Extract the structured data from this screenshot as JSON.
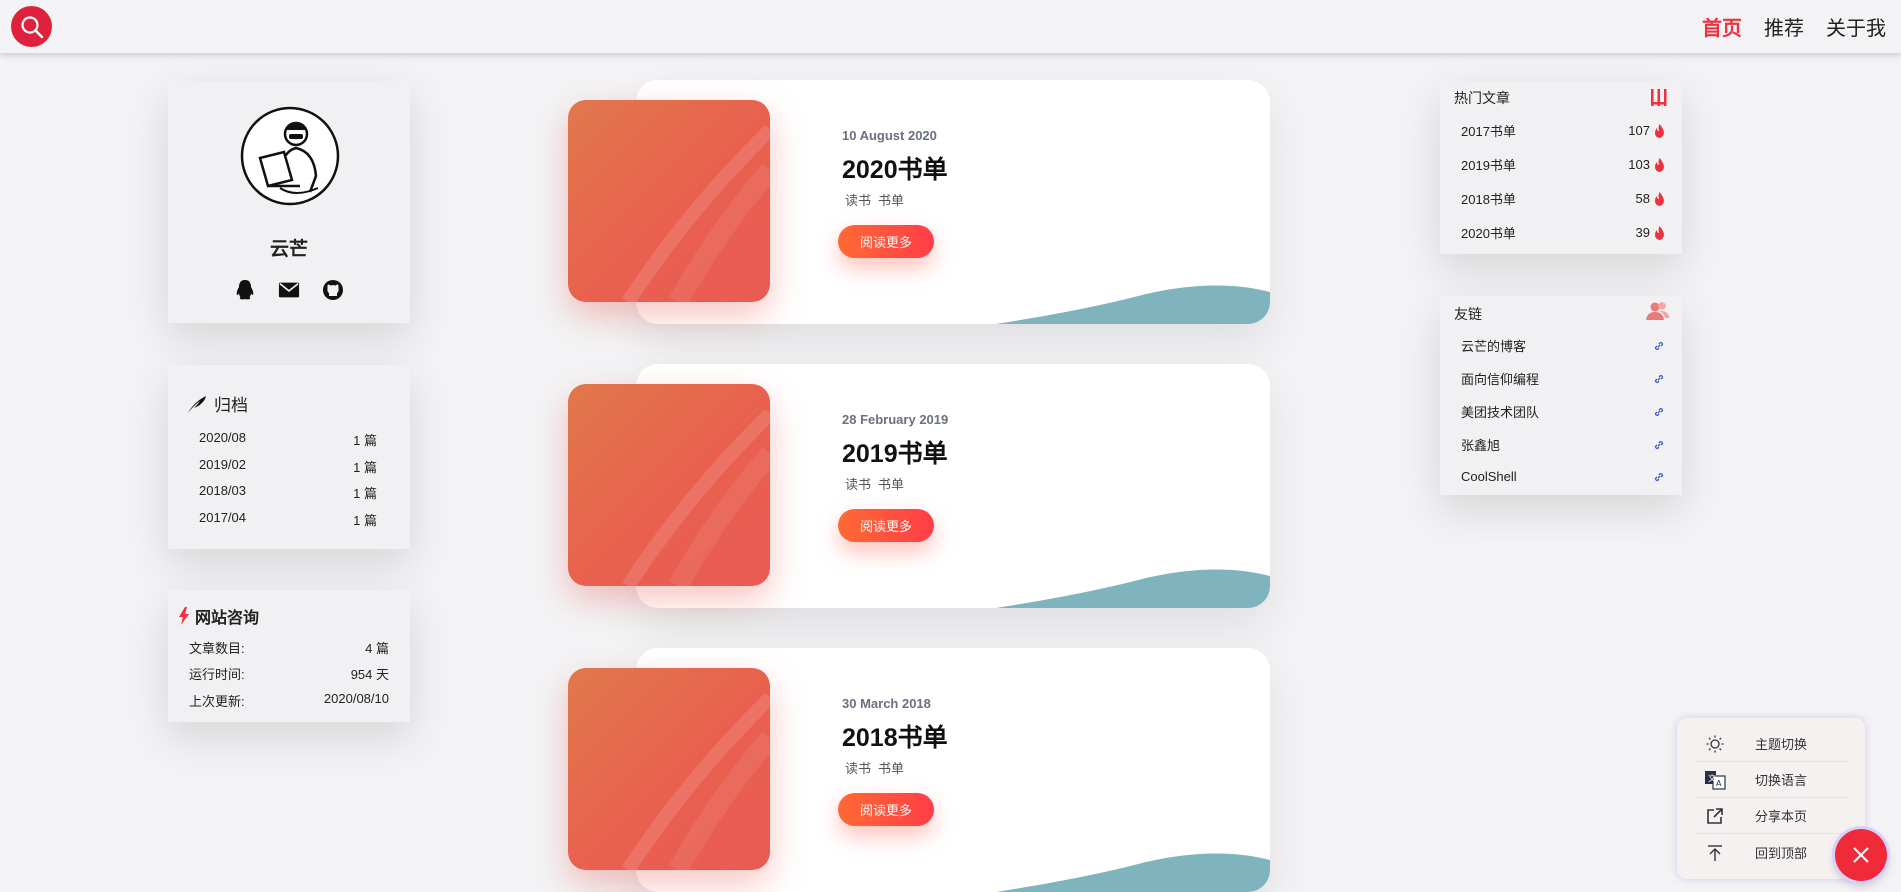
{
  "nav": {
    "items": [
      "首页",
      "推荐",
      "关于我"
    ],
    "active": 0
  },
  "profile": {
    "name": "云芒"
  },
  "archive": {
    "title": "归档",
    "rows": [
      {
        "month": "2020/08",
        "count": "1 篇"
      },
      {
        "month": "2019/02",
        "count": "1 篇"
      },
      {
        "month": "2018/03",
        "count": "1 篇"
      },
      {
        "month": "2017/04",
        "count": "1 篇"
      }
    ]
  },
  "site_info": {
    "title": "网站咨询",
    "rows": [
      {
        "label": "文章数目:",
        "value": "4 篇"
      },
      {
        "label": "运行时间:",
        "value": "954 天"
      },
      {
        "label": "上次更新:",
        "value": "2020/08/10"
      }
    ]
  },
  "posts": [
    {
      "date": "10 August 2020",
      "title": "2020书单",
      "tags": [
        "读书",
        "书单"
      ],
      "button": "阅读更多"
    },
    {
      "date": "28 February 2019",
      "title": "2019书单",
      "tags": [
        "读书",
        "书单"
      ],
      "button": "阅读更多"
    },
    {
      "date": "30 March 2018",
      "title": "2018书单",
      "tags": [
        "读书",
        "书单"
      ],
      "button": "阅读更多"
    }
  ],
  "hot": {
    "title": "热门文章",
    "items": [
      {
        "title": "2017书单",
        "count": "107"
      },
      {
        "title": "2019书单",
        "count": "103"
      },
      {
        "title": "2018书单",
        "count": "58"
      },
      {
        "title": "2020书单",
        "count": "39"
      }
    ]
  },
  "links": {
    "title": "友链",
    "items": [
      "云芒的博客",
      "面向信仰编程",
      "美团技术团队",
      "张鑫旭",
      "CoolShell"
    ]
  },
  "float_menu": {
    "items": [
      {
        "label": "主题切换",
        "icon": "sun-icon"
      },
      {
        "label": "切换语言",
        "icon": "translate-icon"
      },
      {
        "label": "分享本页",
        "icon": "share-icon"
      },
      {
        "label": "回到顶部",
        "icon": "back-to-top-icon"
      }
    ]
  },
  "colors": {
    "accent": "#f0313d",
    "button_gradient": [
      "#ff6a34",
      "#ff3d47"
    ],
    "wave": "#7fb3bd"
  }
}
